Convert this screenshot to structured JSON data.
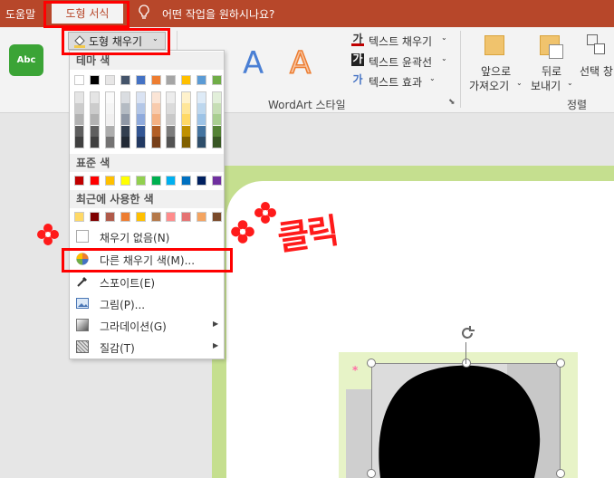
{
  "titlebar": {
    "help_label": "도움말",
    "active_tab": "도형 서식",
    "tell_me": "어떤 작업을 원하시나요?"
  },
  "ribbon": {
    "shape_style_sample": "Abc",
    "fill_button_label": "도형 채우기",
    "wordart_letters": [
      "A",
      "A"
    ],
    "text_fill": "텍스트 채우기",
    "text_outline": "텍스트 윤곽선",
    "text_effect": "텍스트 효과",
    "wordart_group_label": "WordArt 스타일",
    "bring_forward_line1": "앞으로",
    "bring_forward_line2": "가져오기",
    "send_backward_line1": "뒤로",
    "send_backward_line2": "보내기",
    "selection_pane": "선택 창",
    "arrange_group_label": "정렬"
  },
  "dropdown": {
    "theme_colors_header": "테마 색",
    "standard_colors_header": "표준 색",
    "recent_colors_header": "최근에 사용한 색",
    "no_fill": "채우기 없음(N)",
    "more_fill_colors": "다른 채우기 색(M)...",
    "eyedropper": "스포이트(E)",
    "picture": "그림(P)...",
    "gradient": "그라데이션(G)",
    "texture": "질감(T)",
    "theme_top_colors": [
      "#ffffff",
      "#000000",
      "#e7e6e6",
      "#44546a",
      "#4472c4",
      "#ed7d31",
      "#a5a5a5",
      "#ffc000",
      "#5b9bd5",
      "#70ad47"
    ],
    "standard_colors": [
      "#c00000",
      "#ff0000",
      "#ffc000",
      "#ffff00",
      "#92d050",
      "#00b050",
      "#00b0f0",
      "#0070c0",
      "#002060",
      "#7030a0"
    ],
    "recent_colors": [
      "#ffd966",
      "#7f0000",
      "#b05a4a",
      "#ed7d31",
      "#ffc000",
      "#b5794a",
      "#ff8c8c",
      "#e57373",
      "#f4a460",
      "#7a4a2a"
    ]
  },
  "annotation": {
    "click_text": "클릭"
  },
  "icons": {
    "lightbulb": "lightbulb-icon",
    "paint_bucket": "paint-bucket-icon",
    "eyedropper": "eyedropper-icon",
    "picture": "picture-icon",
    "gradient": "gradient-icon",
    "texture": "texture-icon",
    "color_wheel": "color-wheel-icon",
    "rotate": "rotate-handle-icon"
  }
}
